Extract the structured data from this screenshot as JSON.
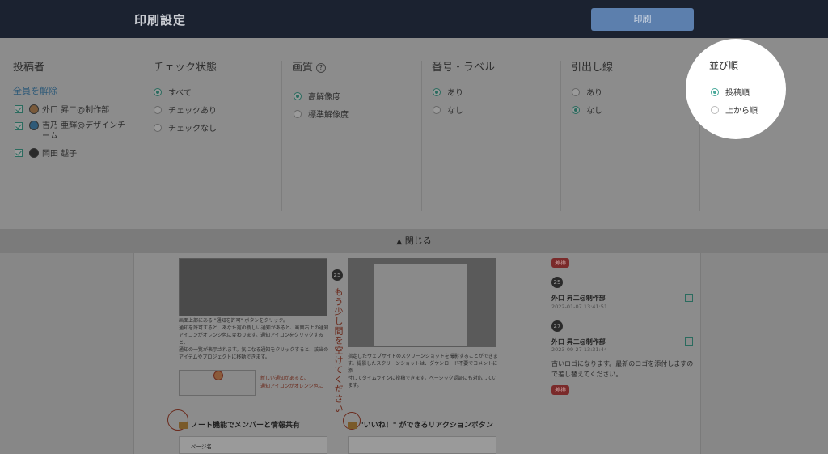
{
  "header": {
    "title": "印刷設定",
    "print_label": "印刷"
  },
  "settings": {
    "posters": {
      "title": "投稿者",
      "deselect_all": "全員を解除",
      "users": [
        {
          "name": "外口 昇二@制作部"
        },
        {
          "name": "吉乃 亜輝@デザインチ",
          "name_cont": "ーム"
        },
        {
          "name": "岡田 越子"
        }
      ]
    },
    "check_state": {
      "title": "チェック状態",
      "options": [
        "すべて",
        "チェックあり",
        "チェックなし"
      ],
      "selected": "すべて"
    },
    "quality": {
      "title": "画質",
      "help": "?",
      "options": [
        "高解像度",
        "標準解像度"
      ],
      "selected": "高解像度"
    },
    "number_label": {
      "title": "番号・ラベル",
      "options": [
        "あり",
        "なし"
      ],
      "selected": "あり"
    },
    "leader_line": {
      "title": "引出し線",
      "options": [
        "あり",
        "なし"
      ],
      "selected": "なし"
    },
    "order": {
      "title": "並び順",
      "options": [
        "投稿順",
        "上から順"
      ],
      "selected": "投稿順"
    }
  },
  "close_bar": {
    "label": "閉じる",
    "icon": "chevron-up-icon"
  },
  "preview": {
    "left_text": [
      "画面上部にある \"通知を許可\" ボタンをクリック。",
      "通知を許可すると、あなた宛の新しい通知があると、画面右上の通知",
      "アイコンがオレンジ色に変わります。通知アイコンをクリックすると、",
      "通知の一覧が表示されます。気になる通知をクリックすると、該当の",
      "アイテムやプロジェクトに移動できます。"
    ],
    "annotation_red": [
      "新しい通知があると、",
      "通知アイコンがオレンジ色に"
    ],
    "center_text": [
      "指定したウェブサイトのスクリーンショットを撮影することができま",
      "す。撮影したスクリーンショットは、ダウンロード不要でコメントに添",
      "付してタイムラインに投稿できます。ベーシック認証にも対応してい",
      "ます。"
    ],
    "vertical_note": "もう少し間を空けてください",
    "pin_number": "25",
    "heading_left": "ノート機能でメンバーと情報共有",
    "heading_right": "\"いいね！\" ができるリアクションボタン",
    "table_label": "ページ名"
  },
  "comments": [
    {
      "tag": "差換"
    },
    {
      "num": "25",
      "author": "外口 昇二@制作部",
      "date": "2022-01-07 13:41:51"
    },
    {
      "num": "27",
      "author": "外口 昇二@制作部",
      "date": "2023-09-27 13:31:44",
      "text": "古いロゴになります。最新のロゴを添付しますので差し替えてください。",
      "tag": "差換"
    }
  ],
  "colors": {
    "topbar": "#1b2230",
    "print_button": "#5c7fad",
    "accent": "#49a99a",
    "overlay": "#8c8c8c"
  }
}
